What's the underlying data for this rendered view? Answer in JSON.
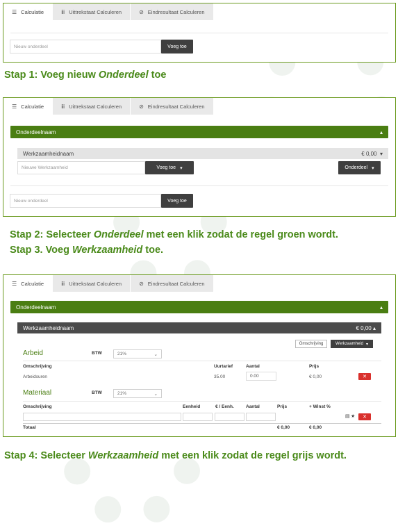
{
  "tabs": {
    "calculatie": "Calculatie",
    "uittrekstaat": "Uittrekstaat Calculeren",
    "eindresultaat": "Eindresultaat Calculeren"
  },
  "panel1": {
    "onderdeel_placeholder": "Nieuw onderdeel",
    "voeg_toe": "Voeg toe"
  },
  "stap1": {
    "pre": "Stap 1: Voeg nieuw ",
    "em": "Onderdeel",
    "post": " toe"
  },
  "panel2": {
    "onderdeel_name": "Onderdeelnaam",
    "werkzaamheid_name": "Werkzaamheidnaam",
    "werkzaamheid_amount": "€ 0,00",
    "werkzaamheid_placeholder": "Nieuwe Werkzaamheid",
    "voeg_toe": "Voeg toe",
    "onderdeel_button": "Onderdeel",
    "onderdeel_placeholder": "Nieuw onderdeel",
    "voeg_toe_2": "Voeg toe"
  },
  "stap2": {
    "pre": "Stap 2: Selecteer ",
    "em": "Onderdeel",
    "post": " met een klik zodat de regel groen wordt."
  },
  "stap3": {
    "pre": "Stap 3. Voeg ",
    "em": "Werkzaamheid",
    "post": " toe."
  },
  "panel3": {
    "onderdeel_name": "Onderdeelnaam",
    "werkzaamheid_name": "Werkzaamheidnaam",
    "werkzaamheid_amount": "€ 0,00",
    "omschrijving_button": "Omschrijving",
    "werkzaamheid_button": "Werkzaamheid",
    "arbeid": {
      "title": "Arbeid",
      "btw_label": "BTW",
      "btw_value": "21%",
      "col_omschrijving": "Omschrijving",
      "col_uurtarief": "Uurtarief",
      "col_aantal": "Aantal",
      "col_prijs": "Prijs",
      "row_omschrijving": "Arbeidsuren",
      "row_uurtarief": "35.00",
      "row_aantal": "0.00",
      "row_prijs": "€ 0,00",
      "delete": "✕"
    },
    "materiaal": {
      "title": "Materiaal",
      "btw_label": "BTW",
      "btw_value": "21%",
      "col_omschrijving": "Omschrijving",
      "col_eenheid": "Eenheid",
      "col_per_eenheid": "€ / Eenh.",
      "col_aantal": "Aantal",
      "col_prijs": "Prijs",
      "col_winst": "+ Winst %",
      "delete": "✕",
      "totaal_label": "Totaal",
      "totaal_prijs": "€ 0,00",
      "totaal_winst": "€ 0,00"
    }
  },
  "stap4": {
    "pre": "Stap 4: Selecteer ",
    "em": "Werkzaamheid",
    "post": " met een klik zodat de regel grijs  wordt."
  }
}
